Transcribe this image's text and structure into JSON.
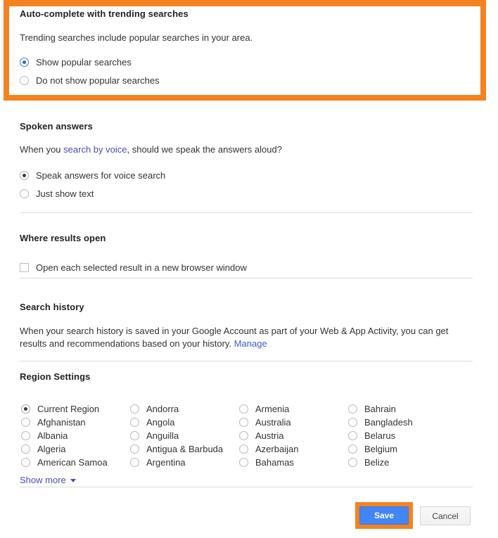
{
  "colors": {
    "highlight_orange": "#F58220",
    "save_blue": "#4285f4",
    "link_purple": "#4b4bb5",
    "divider": "#dcdcdc"
  },
  "autocomplete": {
    "title": "Auto-complete with trending searches",
    "description": "Trending searches include popular searches in your area.",
    "options": [
      {
        "label": "Show popular searches",
        "selected": true
      },
      {
        "label": "Do not show popular searches",
        "selected": false
      }
    ]
  },
  "spoken_answers": {
    "title": "Spoken answers",
    "desc_before": "When you ",
    "desc_link": "search by voice",
    "desc_after": ", should we speak the answers aloud?",
    "options": [
      {
        "label": "Speak answers for voice search",
        "selected": true
      },
      {
        "label": "Just show text",
        "selected": false
      }
    ]
  },
  "where_results_open": {
    "title": "Where results open",
    "checkbox_label": "Open each selected result in a new browser window",
    "checked": false
  },
  "search_history": {
    "title": "Search history",
    "desc_before": "When your search history is saved in your Google Account as part of your Web & App Activity, you can get results and recommendations based on your history. ",
    "desc_link": "Manage"
  },
  "region_settings": {
    "title": "Region Settings",
    "columns": [
      [
        "Current Region",
        "Afghanistan",
        "Albania",
        "Algeria",
        "American Samoa"
      ],
      [
        "Andorra",
        "Angola",
        "Anguilla",
        "Antigua & Barbuda",
        "Argentina"
      ],
      [
        "Armenia",
        "Australia",
        "Austria",
        "Azerbaijan",
        "Bahamas"
      ],
      [
        "Bahrain",
        "Bangladesh",
        "Belarus",
        "Belgium",
        "Belize"
      ]
    ],
    "selected": "Current Region",
    "show_more_label": "Show more"
  },
  "footer": {
    "save_label": "Save",
    "cancel_label": "Cancel"
  }
}
